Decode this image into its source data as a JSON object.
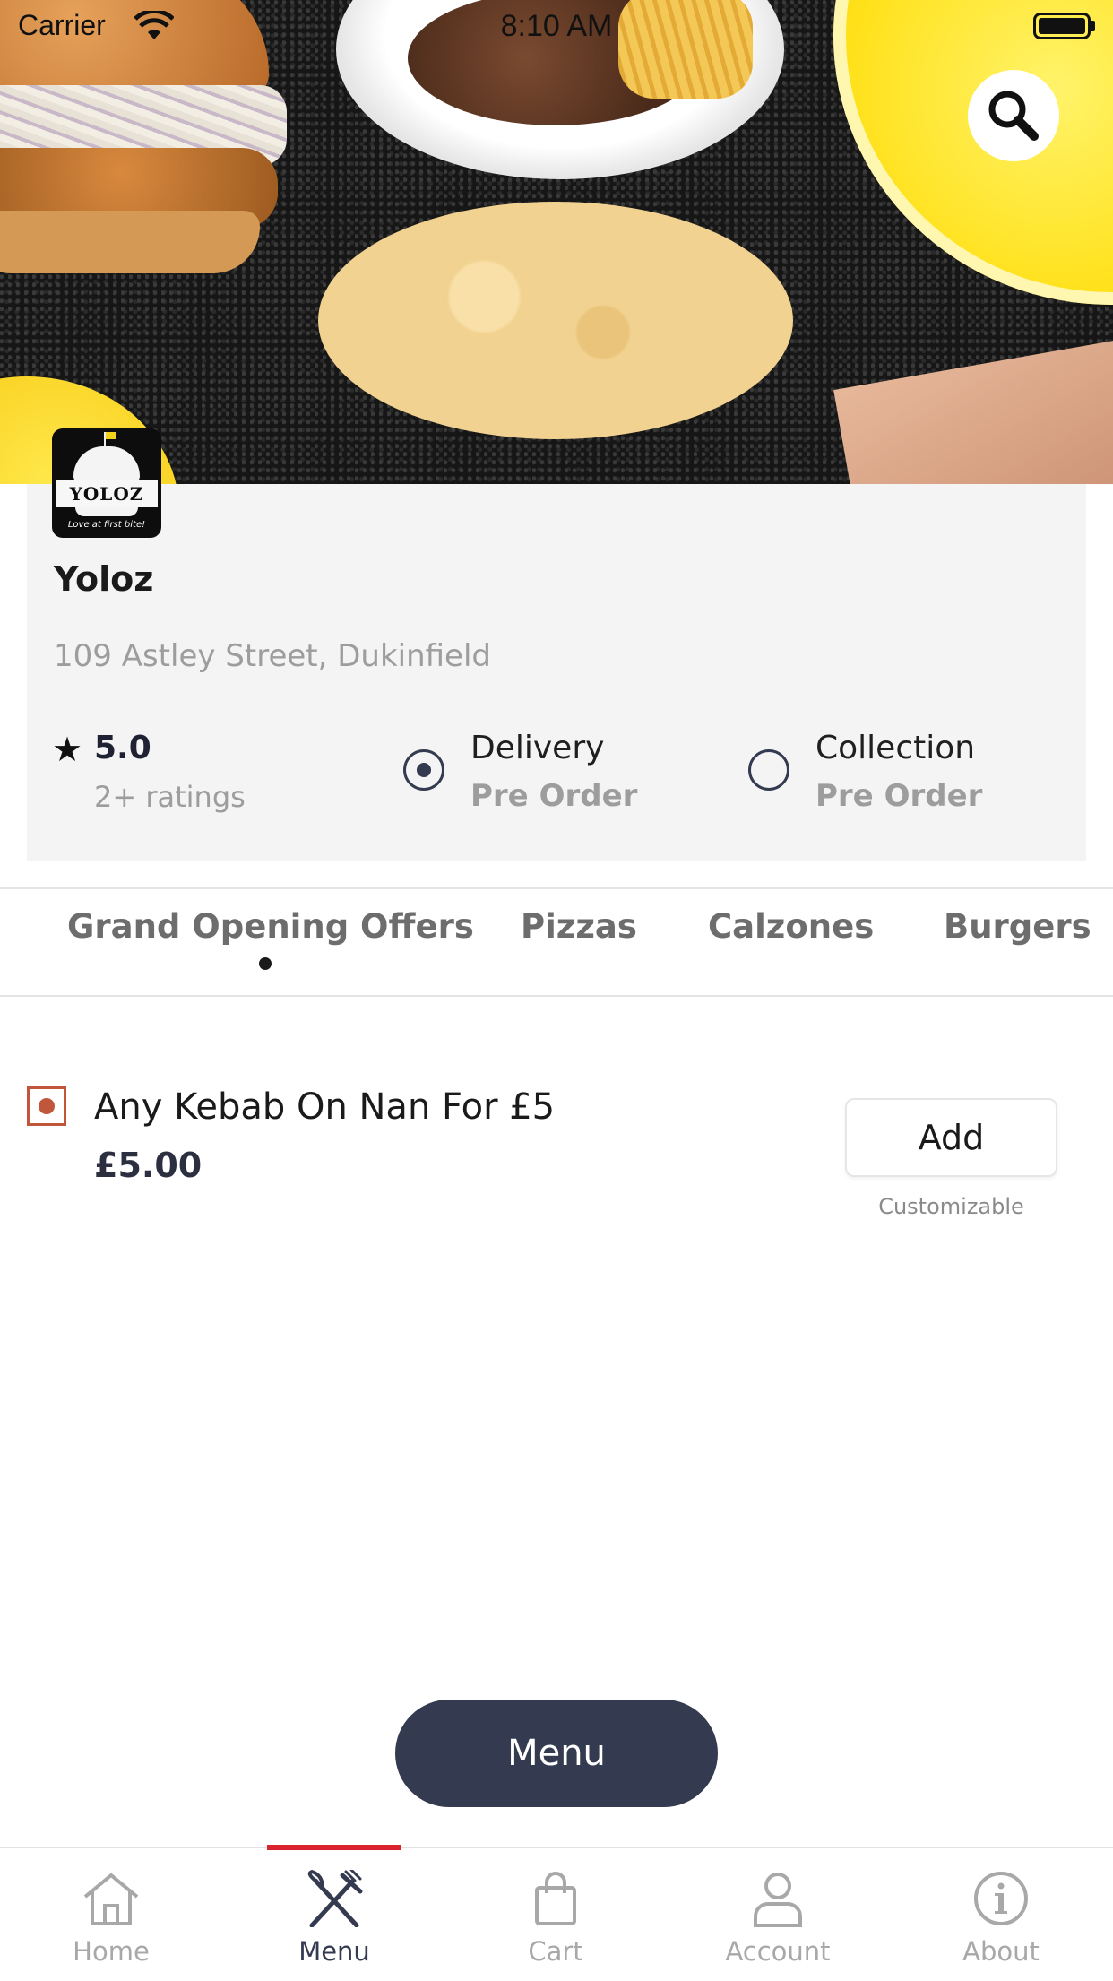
{
  "status_bar": {
    "carrier": "Carrier",
    "time": "8:10 AM"
  },
  "restaurant": {
    "logo_text": "YOLOZ",
    "logo_tagline": "Love at first bite!",
    "name": "Yoloz",
    "address": "109 Astley Street, Dukinfield",
    "rating": "5.0",
    "rating_count": "2+ ratings"
  },
  "order_types": [
    {
      "title": "Delivery",
      "subtitle": "Pre Order",
      "selected": true
    },
    {
      "title": "Collection",
      "subtitle": "Pre Order",
      "selected": false
    }
  ],
  "category_tabs": [
    "Grand Opening Offers",
    "Pizzas",
    "Calzones",
    "Burgers"
  ],
  "active_category": "Grand Opening Offers",
  "menu_items": [
    {
      "name": "Any Kebab On Nan For £5",
      "price": "£5.00",
      "add_label": "Add",
      "note": "Customizable"
    }
  ],
  "menu_button": "Menu",
  "bottom_nav": [
    {
      "label": "Home",
      "icon": "home-icon",
      "active": false
    },
    {
      "label": "Menu",
      "icon": "fork-knife-icon",
      "active": true
    },
    {
      "label": "Cart",
      "icon": "shopping-bag-icon",
      "active": false
    },
    {
      "label": "Account",
      "icon": "user-icon",
      "active": false
    },
    {
      "label": "About",
      "icon": "info-icon",
      "active": false
    }
  ],
  "colors": {
    "accent": "#d9242e",
    "primary": "#343a4f",
    "veg_mark": "#c0573b"
  }
}
